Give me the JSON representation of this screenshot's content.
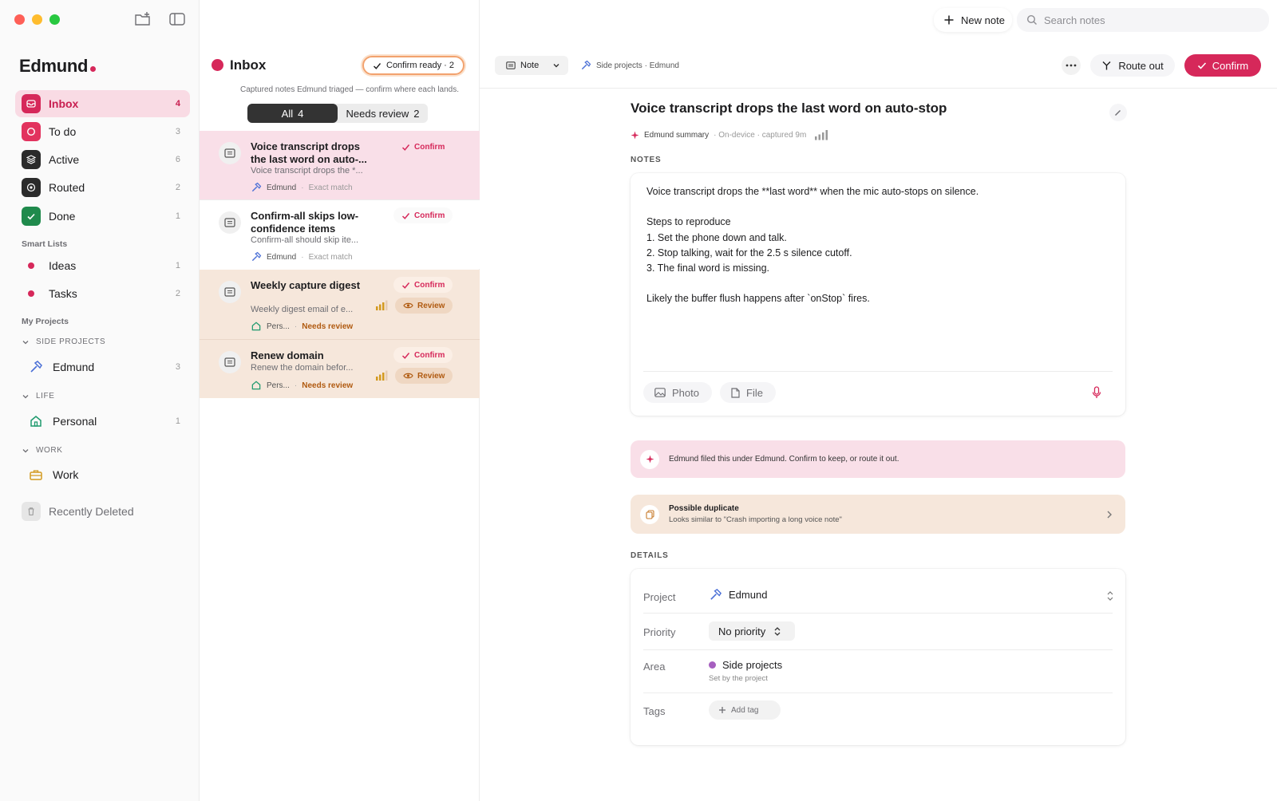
{
  "app": {
    "brand": "Edmund"
  },
  "colors": {
    "accent": "#d6285a",
    "review": "#b05a10",
    "sidebar_active_bg": "#f9dbe4"
  },
  "sidebar": {
    "items": [
      {
        "label": "Inbox",
        "count": "4",
        "icon": "inbox-icon"
      },
      {
        "label": "To do",
        "count": "3",
        "icon": "circle-icon"
      },
      {
        "label": "Active",
        "count": "6",
        "icon": "layers-icon"
      },
      {
        "label": "Routed",
        "count": "2",
        "icon": "compass-icon"
      },
      {
        "label": "Done",
        "count": "1",
        "icon": "check-icon"
      }
    ],
    "smart_lists_label": "Smart Lists",
    "smart_lists": [
      {
        "label": "Ideas",
        "count": "1"
      },
      {
        "label": "Tasks",
        "count": "2"
      }
    ],
    "my_projects_label": "My Projects",
    "groups": [
      {
        "label": "SIDE PROJECTS",
        "item": "Edmund",
        "count": "3",
        "icon": "hammer-icon"
      },
      {
        "label": "LIFE",
        "item": "Personal",
        "count": "1",
        "icon": "house-icon"
      },
      {
        "label": "WORK",
        "item": "Work",
        "count": "",
        "icon": "briefcase-icon"
      }
    ],
    "recently_deleted": "Recently Deleted"
  },
  "list": {
    "title": "Inbox",
    "confirm_ready": "Confirm ready · 2",
    "subtitle": "Captured notes Edmund triaged — confirm where each lands.",
    "segments": [
      {
        "label": "All",
        "count": "4"
      },
      {
        "label": "Needs review",
        "count": "2"
      }
    ],
    "cards": [
      {
        "title": "Voice transcript drops the last word on auto-...",
        "excerpt": "Voice transcript drops the *...",
        "project": "Edmund",
        "match": "Exact match",
        "confirm": "Confirm"
      },
      {
        "title": "Confirm-all skips low-confidence items",
        "excerpt": "Confirm-all should skip ite...",
        "project": "Edmund",
        "match": "Exact match",
        "confirm": "Confirm"
      },
      {
        "title": "Weekly capture digest",
        "excerpt": "Weekly digest email of e...",
        "project": "Pers...",
        "match": "Needs review",
        "confirm": "Confirm",
        "review": "Review"
      },
      {
        "title": "Renew domain",
        "excerpt": "Renew the domain befor...",
        "project": "Pers...",
        "match": "Needs review",
        "confirm": "Confirm",
        "review": "Review"
      }
    ]
  },
  "topbar": {
    "new_note": "New note",
    "search_placeholder": "Search notes"
  },
  "toolbar": {
    "type": "Note",
    "breadcrumb": "Side projects · Edmund",
    "route_out": "Route out",
    "confirm": "Confirm"
  },
  "note": {
    "title": "Voice transcript drops the last word on auto-stop",
    "summary_label": "Edmund summary",
    "summary_meta": "· On-device · captured 9m",
    "notes_label": "NOTES",
    "body": [
      "Voice transcript drops the **last word** when the mic auto-stops on silence.",
      "",
      "Steps to reproduce",
      "1. Set the phone down and talk.",
      "2. Stop talking, wait for the 2.5 s silence cutoff.",
      "3. The final word is missing.",
      "",
      "Likely the buffer flush happens after `onStop` fires."
    ],
    "photo": "Photo",
    "file": "File",
    "filed_banner": "Edmund filed this under Edmund. Confirm to keep, or route it out.",
    "duplicate_title": "Possible duplicate",
    "duplicate_sub": "Looks similar to \"Crash importing a long voice note\"",
    "details_label": "DETAILS",
    "details": {
      "project_label": "Project",
      "project_value": "Edmund",
      "priority_label": "Priority",
      "priority_value": "No priority",
      "area_label": "Area",
      "area_value": "Side projects",
      "area_sub": "Set by the project",
      "tags_label": "Tags",
      "add_tag": "Add tag"
    }
  }
}
